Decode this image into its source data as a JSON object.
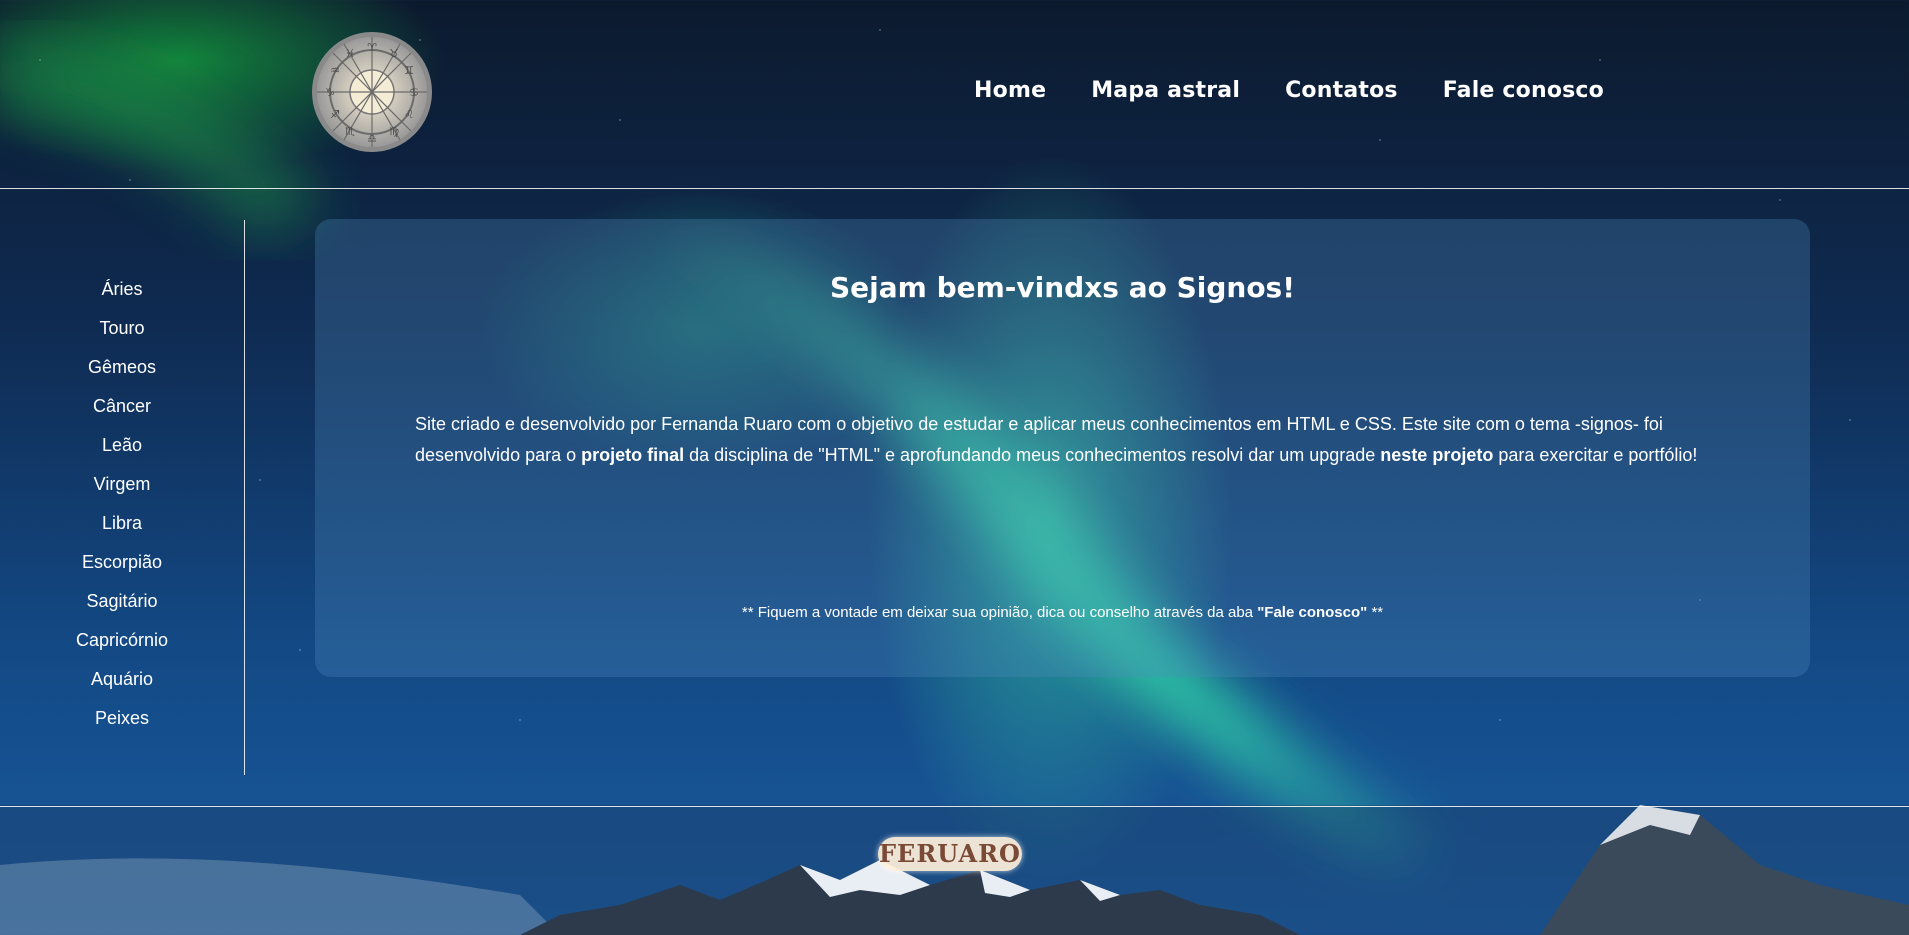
{
  "header": {
    "nav": [
      "Home",
      "Mapa astral",
      "Contatos",
      "Fale conosco"
    ]
  },
  "sidebar": {
    "items": [
      "Áries",
      "Touro",
      "Gêmeos",
      "Câncer",
      "Leão",
      "Virgem",
      "Libra",
      "Escorpião",
      "Sagitário",
      "Capricórnio",
      "Aquário",
      "Peixes"
    ]
  },
  "main": {
    "title": "Sejam bem-vindxs ao Signos!",
    "intro_part1": "Site criado e desenvolvido por Fernanda Ruaro com o objetivo de estudar e aplicar meus conhecimentos em HTML e CSS. Este site com o tema -signos- foi desenvolvido para o ",
    "intro_bold1": "projeto final",
    "intro_part2": " da disciplina de \"HTML\" e aprofundando meus conhecimentos resolvi dar um upgrade ",
    "intro_bold2": "neste projeto",
    "intro_part3": " para exercitar e portfólio!",
    "note_part1": "** Fiquem a vontade em deixar sua opinião, dica ou conselho através da aba ",
    "note_bold": "\"Fale conosco\"",
    "note_part2": " **"
  },
  "footer": {
    "signature": "FERUARO"
  },
  "icons": {
    "logo": "zodiac-wheel-icon"
  },
  "colors": {
    "sky_top": "#0c1a2e",
    "sky_bottom": "#1b5aa0",
    "aurora": "#3cebaa",
    "signature_text": "#7a4a36"
  }
}
